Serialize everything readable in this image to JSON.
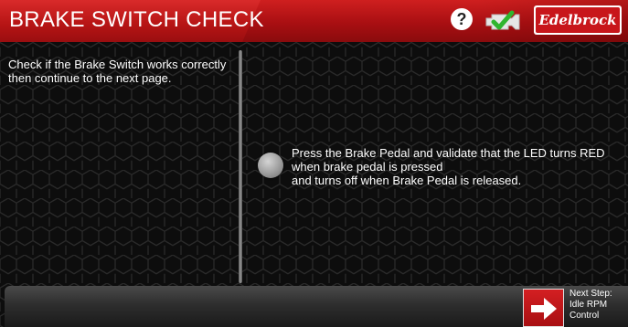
{
  "header": {
    "title": "BRAKE SWITCH CHECK",
    "help_symbol": "?",
    "logo_text": "Edelbrock",
    "icons": [
      "help-icon",
      "engine-check-icon"
    ],
    "accent_color": "#c8161b"
  },
  "left_panel": {
    "instruction_lines": [
      "Check if the Brake Switch works correctly",
      "then continue to the next page."
    ]
  },
  "right_panel": {
    "led_state": "off",
    "led_color": "#9c9c9c",
    "instruction_lines": [
      "Press the Brake Pedal and validate that the LED turns RED when brake pedal is pressed",
      "and turns off when Brake Pedal is released."
    ]
  },
  "footer": {
    "next_step_lines": [
      "Next Step:",
      "Idle RPM",
      "Control"
    ],
    "next_icon": "arrow-right-icon"
  }
}
